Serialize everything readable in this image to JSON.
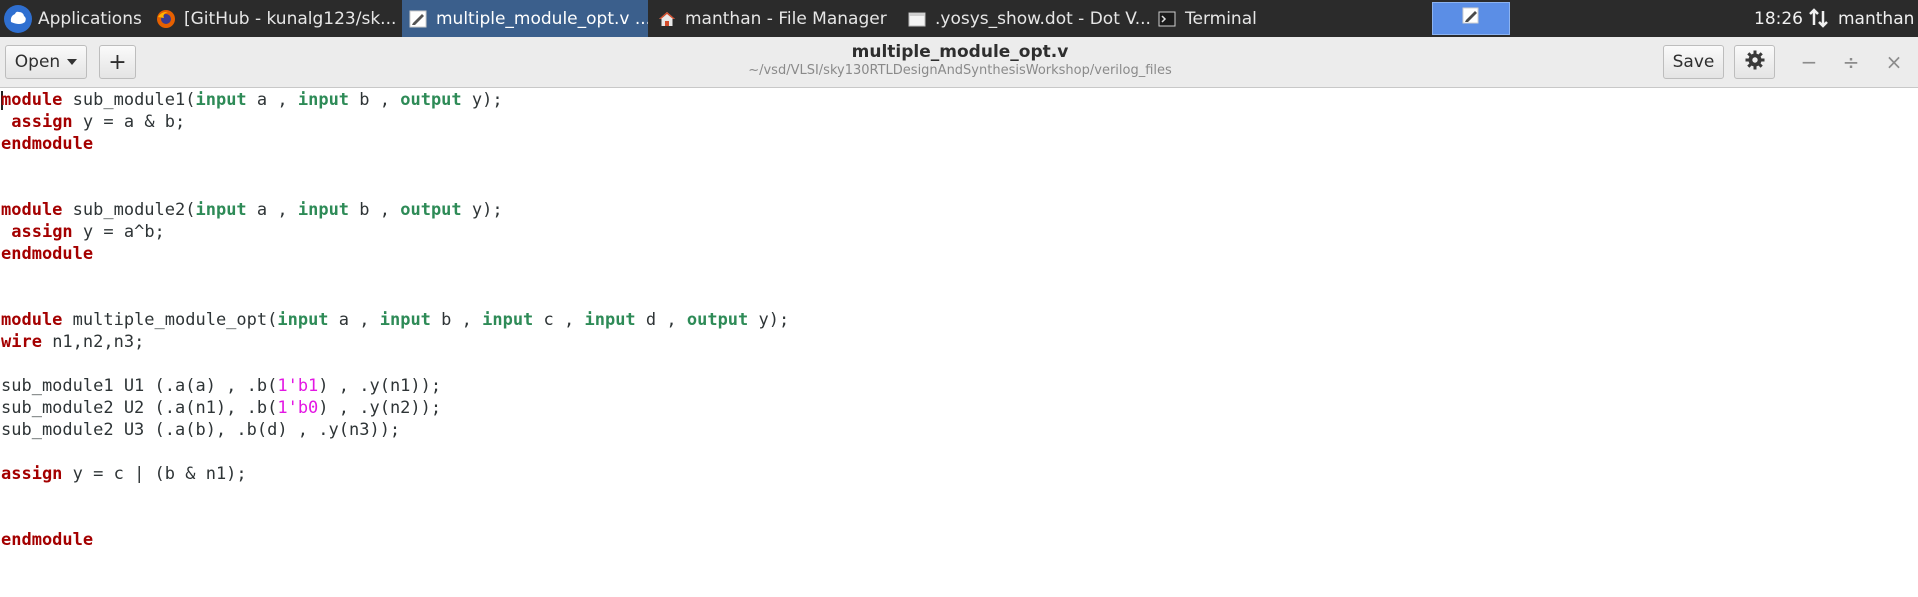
{
  "taskbar": {
    "apps_label": "Applications",
    "tasks": [
      {
        "label": "[GitHub - kunalg123/sk...",
        "icon": "firefox-icon"
      },
      {
        "label": "multiple_module_opt.v ...",
        "icon": "text-editor-icon"
      },
      {
        "label": "manthan - File Manager",
        "icon": "home-folder-icon"
      },
      {
        "label": ".yosys_show.dot - Dot V...",
        "icon": "window-icon"
      },
      {
        "label": "Terminal",
        "icon": "terminal-icon"
      }
    ],
    "clock": "18:26",
    "user": "manthan"
  },
  "header": {
    "open_label": "Open",
    "new_tab_label": "+",
    "title": "multiple_module_opt.v",
    "path": "~/vsd/VLSI/sky130RTLDesignAndSynthesisWorkshop/verilog_files",
    "save_label": "Save",
    "minimize": "−",
    "maximize": "÷",
    "close": "×"
  },
  "code": {
    "l1": [
      "module",
      " sub_module1(",
      "input",
      " a , ",
      "input",
      " b , ",
      "output",
      " y);"
    ],
    "l2": [
      " ",
      "assign",
      " y = a & b;"
    ],
    "l3": [
      "endmodule"
    ],
    "l4": [
      "module",
      " sub_module2(",
      "input",
      " a , ",
      "input",
      " b , ",
      "output",
      " y);"
    ],
    "l5": [
      " ",
      "assign",
      " y = a^b;"
    ],
    "l6": [
      "endmodule"
    ],
    "l7": [
      "module",
      " multiple_module_opt(",
      "input",
      " a , ",
      "input",
      " b , ",
      "input",
      " c , ",
      "input",
      " d , ",
      "output",
      " y);"
    ],
    "l8": [
      "wire",
      " n1,n2,n3;"
    ],
    "l9": [
      "sub_module1 U1 (.a(a) , .b(",
      "1'b1",
      ") , .y(n1));"
    ],
    "l10": [
      "sub_module2 U2 (.a(n1), .b(",
      "1'b0",
      ") , .y(n2));"
    ],
    "l11": [
      "sub_module2 U3 (.a(b), .b(d) , .y(n3));"
    ],
    "l12": [
      "assign",
      " y = c | (b & n1);"
    ],
    "l13": [
      "endmodule"
    ]
  }
}
